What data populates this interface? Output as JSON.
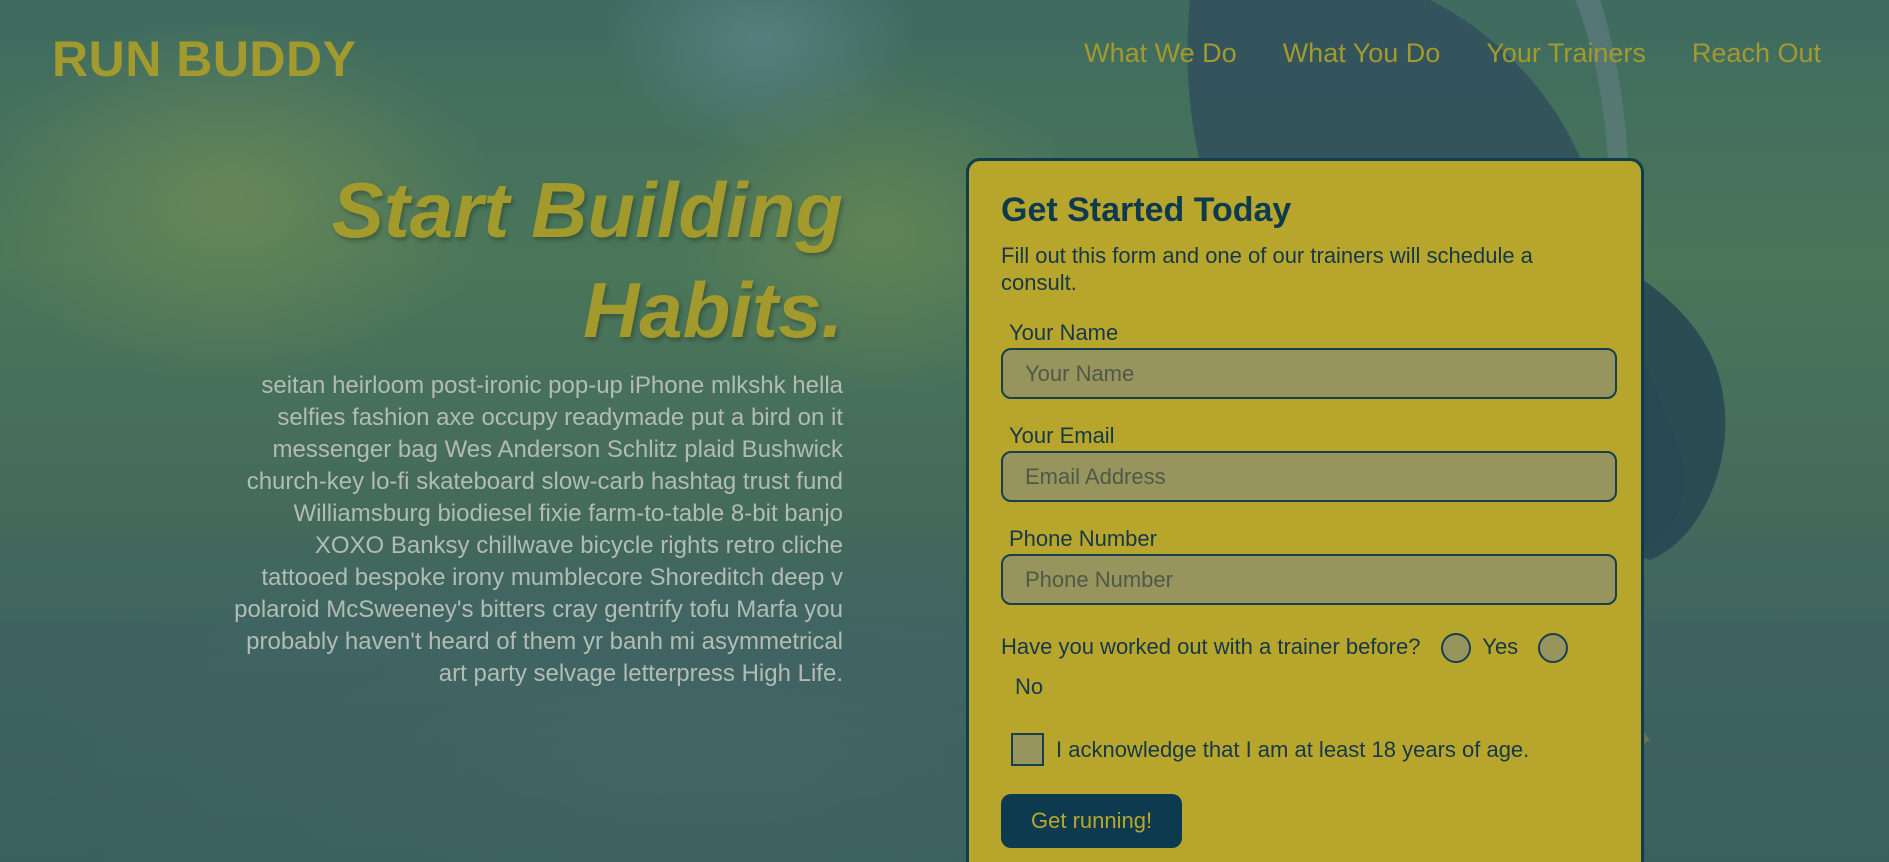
{
  "header": {
    "logo": "RUN BUDDY",
    "nav": [
      {
        "label": "What We Do"
      },
      {
        "label": "What You Do"
      },
      {
        "label": "Your Trainers"
      },
      {
        "label": "Reach Out"
      }
    ]
  },
  "hero": {
    "title_line1": "Start Building",
    "title_line2": "Habits.",
    "body": "seitan heirloom post-ironic pop-up iPhone mlkshk hella selfies fashion axe occupy readymade put a bird on it messenger bag Wes Anderson Schlitz plaid Bushwick church-key lo-fi skateboard slow-carb hashtag trust fund Williamsburg biodiesel fixie farm-to-table 8-bit banjo XOXO Banksy chillwave bicycle rights retro cliche tattooed bespoke irony mumblecore Shoreditch deep v polaroid McSweeney's bitters cray gentrify tofu Marfa you probably haven't heard of them yr banh mi asymmetrical art party selvage letterpress High Life."
  },
  "form": {
    "title": "Get Started Today",
    "intro": "Fill out this form and one of our trainers will schedule a consult.",
    "name": {
      "label": "Your Name",
      "placeholder": "Your Name"
    },
    "email": {
      "label": "Your Email",
      "placeholder": "Email Address"
    },
    "phone": {
      "label": "Phone Number",
      "placeholder": "Phone Number"
    },
    "trainer_question": "Have you worked out with a trainer before?",
    "yes_label": "Yes",
    "no_label": "No",
    "acknowledge": "I acknowledge that I am at least 18 years of age.",
    "submit_label": "Get running!"
  },
  "colors": {
    "accent_yellow": "#a39a2e",
    "card_yellow": "#b8a62c",
    "dark_teal": "#0e3a4f"
  }
}
